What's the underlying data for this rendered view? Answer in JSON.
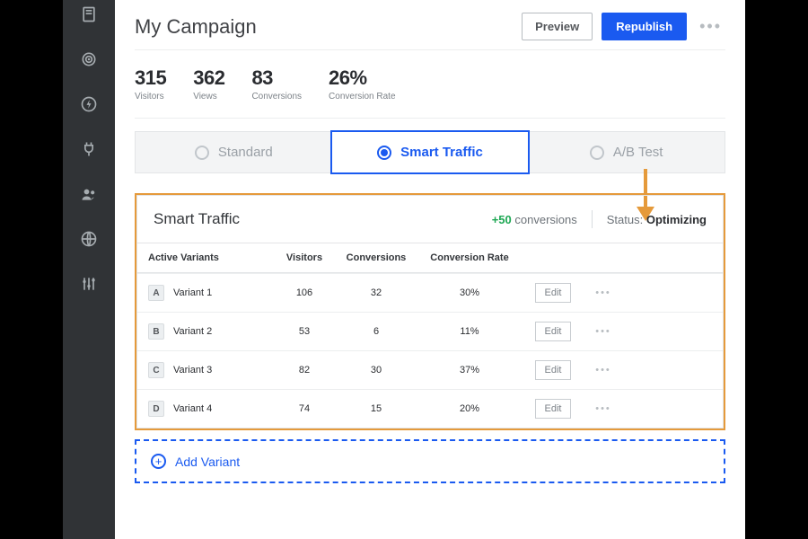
{
  "header": {
    "title": "My Campaign",
    "preview": "Preview",
    "republish": "Republish"
  },
  "stats": [
    {
      "value": "315",
      "label": "Visitors"
    },
    {
      "value": "362",
      "label": "Views"
    },
    {
      "value": "83",
      "label": "Conversions"
    },
    {
      "value": "26%",
      "label": "Conversion Rate"
    }
  ],
  "tabs": {
    "standard": "Standard",
    "smart": "Smart Traffic",
    "ab": "A/B Test"
  },
  "panel": {
    "title": "Smart Traffic",
    "bonus_value": "+50",
    "bonus_label": " conversions",
    "status_label": "Status: ",
    "status_value": "Optimizing"
  },
  "table": {
    "headers": {
      "name": "Active Variants",
      "visitors": "Visitors",
      "conversions": "Conversions",
      "rate": "Conversion Rate"
    },
    "edit_label": "Edit",
    "rows": [
      {
        "letter": "A",
        "name": "Variant 1",
        "visitors": "106",
        "conversions": "32",
        "rate": "30%"
      },
      {
        "letter": "B",
        "name": "Variant 2",
        "visitors": "53",
        "conversions": "6",
        "rate": "11%"
      },
      {
        "letter": "C",
        "name": "Variant 3",
        "visitors": "82",
        "conversions": "30",
        "rate": "37%"
      },
      {
        "letter": "D",
        "name": "Variant 4",
        "visitors": "74",
        "conversions": "15",
        "rate": "20%"
      }
    ]
  },
  "add_variant": "Add Variant",
  "sidebar_icons": [
    "page-icon",
    "target-icon",
    "bolt-icon",
    "plug-icon",
    "users-icon",
    "globe-icon",
    "sliders-icon"
  ],
  "colors": {
    "accent": "#1a5af0",
    "highlight": "#e59a3b",
    "success": "#1ea854"
  }
}
